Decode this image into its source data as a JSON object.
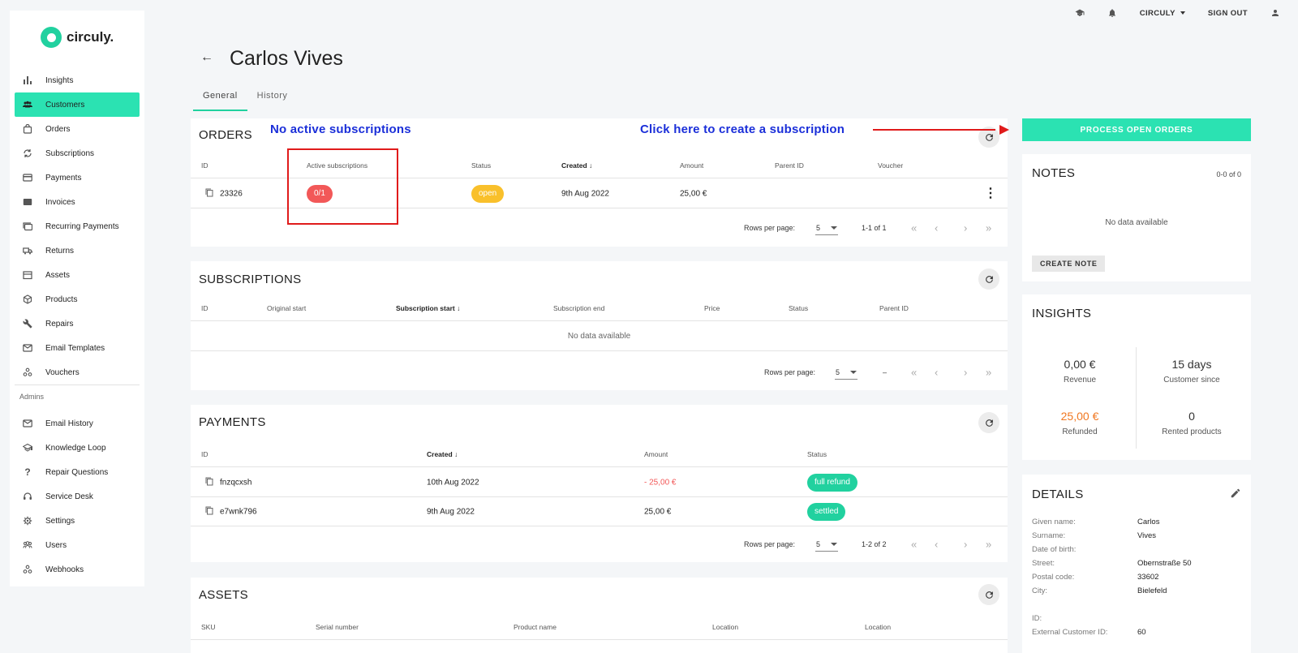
{
  "topbar": {
    "account": "CIRCULY",
    "signout": "SIGN OUT",
    "icons": [
      "graduation-cap-icon",
      "bell-icon",
      "user-icon"
    ]
  },
  "brand": {
    "name": "circuly.",
    "color": "#21d19f"
  },
  "nav": {
    "items": [
      {
        "label": "Insights",
        "icon": "bar-chart-icon"
      },
      {
        "label": "Customers",
        "icon": "people-icon",
        "active": true
      },
      {
        "label": "Orders",
        "icon": "bag-icon"
      },
      {
        "label": "Subscriptions",
        "icon": "cycle-icon"
      },
      {
        "label": "Payments",
        "icon": "card-icon"
      },
      {
        "label": "Invoices",
        "icon": "invoice-icon"
      },
      {
        "label": "Recurring Payments",
        "icon": "cards-icon"
      },
      {
        "label": "Returns",
        "icon": "truck-icon"
      },
      {
        "label": "Assets",
        "icon": "box-icon"
      },
      {
        "label": "Products",
        "icon": "cube-icon"
      },
      {
        "label": "Repairs",
        "icon": "wrench-icon"
      },
      {
        "label": "Email Templates",
        "icon": "mail-icon"
      },
      {
        "label": "Vouchers",
        "icon": "voucher-icon"
      }
    ],
    "admin_label": "Admins",
    "admin_items": [
      {
        "label": "Email History",
        "icon": "mail-icon"
      },
      {
        "label": "Knowledge Loop",
        "icon": "graduation-cap-icon"
      },
      {
        "label": "Repair Questions",
        "icon": "question-icon"
      },
      {
        "label": "Service Desk",
        "icon": "headset-icon"
      },
      {
        "label": "Settings",
        "icon": "gear-icon"
      },
      {
        "label": "Users",
        "icon": "people-icon"
      },
      {
        "label": "Webhooks",
        "icon": "webhook-icon"
      }
    ]
  },
  "page": {
    "title": "Carlos Vives",
    "tabs": [
      "General",
      "History"
    ]
  },
  "annotations": {
    "no_active": "No active subscriptions",
    "click_here": "Click here to create a subscription"
  },
  "orders": {
    "title": "ORDERS",
    "columns": [
      "ID",
      "Active subscriptions",
      "Status",
      "Created",
      "Amount",
      "Parent ID",
      "Voucher"
    ],
    "rows": [
      {
        "id": "23326",
        "active_subs": "0/1",
        "status": "open",
        "created": "9th Aug 2022",
        "amount": "25,00 €"
      }
    ],
    "rows_per_page_label": "Rows per page:",
    "rows_per_page": "5",
    "range": "1-1 of 1"
  },
  "subscriptions": {
    "title": "SUBSCRIPTIONS",
    "columns": [
      "ID",
      "Original start",
      "Subscription start",
      "Subscription end",
      "Price",
      "Status",
      "Parent ID"
    ],
    "empty": "No data available",
    "rows_per_page_label": "Rows per page:",
    "rows_per_page": "5",
    "range": "–"
  },
  "payments": {
    "title": "PAYMENTS",
    "columns": [
      "ID",
      "Created",
      "Amount",
      "Status"
    ],
    "rows": [
      {
        "id": "fnzqcxsh",
        "created": "10th Aug 2022",
        "amount": "- 25,00 €",
        "status": "full refund"
      },
      {
        "id": "e7wnk796",
        "created": "9th Aug 2022",
        "amount": "25,00 €",
        "status": "settled"
      }
    ],
    "rows_per_page_label": "Rows per page:",
    "rows_per_page": "5",
    "range": "1-2 of 2"
  },
  "assets": {
    "title": "ASSETS",
    "columns": [
      "SKU",
      "Serial number",
      "Product name",
      "Location",
      "Location"
    ]
  },
  "right": {
    "process_button": "PROCESS OPEN ORDERS",
    "notes": {
      "title": "NOTES",
      "count": "0-0 of 0",
      "empty": "No data available",
      "create": "CREATE NOTE"
    },
    "insights": {
      "title": "INSIGHTS",
      "stats": [
        {
          "value": "0,00 €",
          "label": "Revenue"
        },
        {
          "value": "15 days",
          "label": "Customer since"
        },
        {
          "value": "25,00 €",
          "label": "Refunded"
        },
        {
          "value": "0",
          "label": "Rented products"
        }
      ]
    },
    "details": {
      "title": "DETAILS",
      "fields": [
        {
          "key": "Given name:",
          "value": "Carlos"
        },
        {
          "key": "Surname:",
          "value": "Vives"
        },
        {
          "key": "Date of birth:",
          "value": ""
        },
        {
          "key": "Street:",
          "value": "Obernstraße 50"
        },
        {
          "key": "Postal code:",
          "value": "33602"
        },
        {
          "key": "City:",
          "value": "Bielefeld"
        },
        {
          "key": "ID:",
          "value": ""
        },
        {
          "key": "External Customer ID:",
          "value": "60"
        }
      ]
    }
  },
  "colors": {
    "accent": "#2be2b2",
    "annotation_blue": "#1b2fd9",
    "annotation_red": "#e01b1b",
    "refund_red": "#f25858",
    "open_yellow": "#f9c02b",
    "refunded_orange": "#f07822"
  }
}
